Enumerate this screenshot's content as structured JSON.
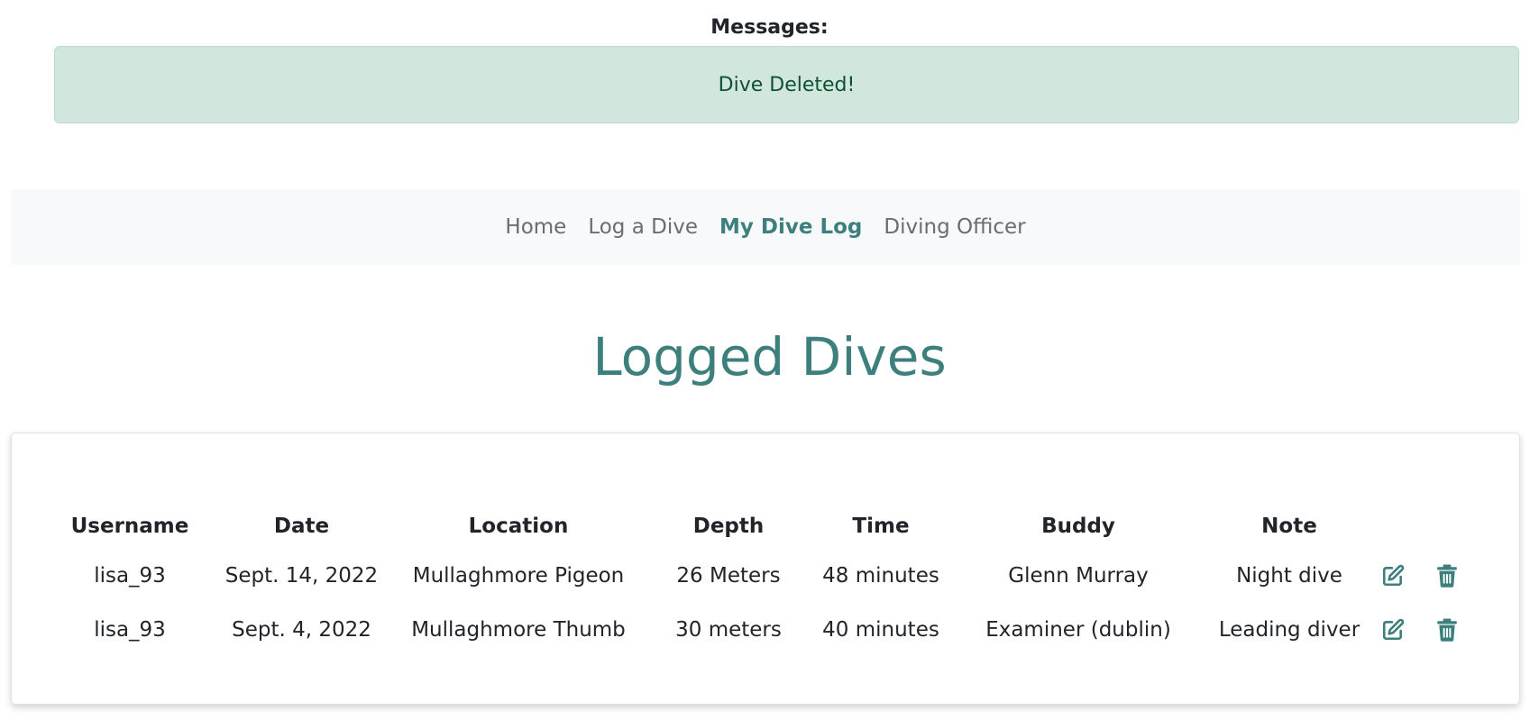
{
  "messages": {
    "heading": "Messages:",
    "alert_text": "Dive Deleted!"
  },
  "nav": {
    "items": [
      {
        "label": "Home",
        "active": false
      },
      {
        "label": "Log a Dive",
        "active": false
      },
      {
        "label": "My Dive Log",
        "active": true
      },
      {
        "label": "Diving Officer",
        "active": false
      }
    ]
  },
  "page": {
    "title": "Logged Dives"
  },
  "table": {
    "headers": [
      "Username",
      "Date",
      "Location",
      "Depth",
      "Time",
      "Buddy",
      "Note"
    ],
    "rows": [
      {
        "username": "lisa_93",
        "date": "Sept. 14, 2022",
        "location": "Mullaghmore Pigeon",
        "depth": "26 Meters",
        "time": "48 minutes",
        "buddy": "Glenn Murray",
        "note": "Night dive",
        "edit_icon": "edit-icon",
        "delete_icon": "trash-icon"
      },
      {
        "username": "lisa_93",
        "date": "Sept. 4, 2022",
        "location": "Mullaghmore Thumb",
        "depth": "30 meters",
        "time": "40 minutes",
        "buddy": "Examiner (dublin)",
        "note": "Leading diver",
        "edit_icon": "edit-icon",
        "delete_icon": "trash-icon"
      }
    ]
  },
  "colors": {
    "accent": "#3d7f7d",
    "alert_bg": "#d1e7dd",
    "alert_text": "#0f5132",
    "nav_bg": "#f8f9fa"
  }
}
